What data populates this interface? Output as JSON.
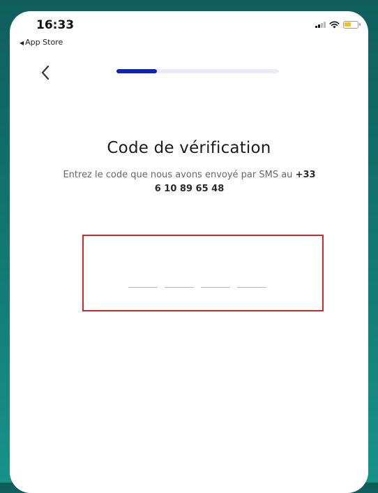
{
  "status_bar": {
    "time": "16:33",
    "back_app": "App Store",
    "signal_icon": "cellular-signal-icon",
    "wifi_icon": "wifi-icon",
    "battery_icon": "battery-icon",
    "battery_color": "#f2c21b"
  },
  "nav": {
    "back_icon": "chevron-left-icon"
  },
  "progress": {
    "fraction": 0.25,
    "fill_color": "#1020c8",
    "track_color": "#e9ecf7"
  },
  "verification": {
    "title": "Code de vérification",
    "subtitle_prefix": "Entrez le code que nous avons envoyé par SMS au ",
    "phone_number": "+33 6 10 89 65 48"
  },
  "code_input": {
    "slots": [
      "",
      "",
      "",
      ""
    ],
    "highlight_color": "#cc2a2a"
  }
}
